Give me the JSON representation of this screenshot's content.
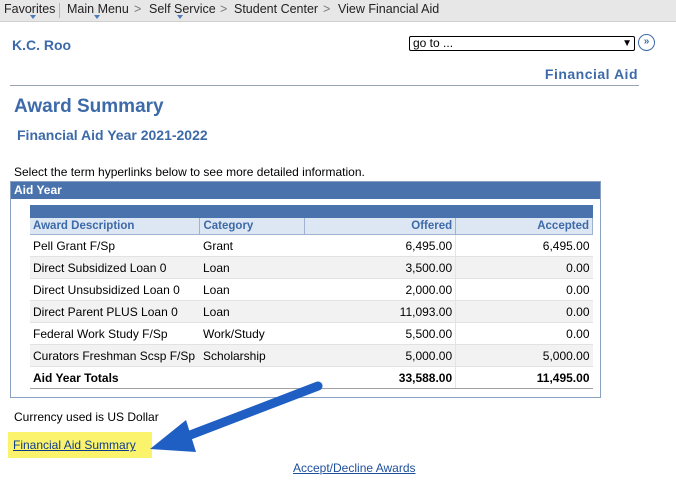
{
  "nav": {
    "favorites": "Favorites",
    "main_menu": "Main Menu",
    "self_service": "Self Service",
    "student_center": "Student Center",
    "view_financial_aid": "View Financial Aid",
    "separator": ">"
  },
  "header": {
    "student_name": "K.C. Roo",
    "goto_value": "go to ...",
    "page_label": "Financial Aid"
  },
  "main": {
    "title": "Award Summary",
    "aid_year_title": "Financial Aid Year 2021-2022",
    "instructions": "Select the term hyperlinks below to see more detailed information.",
    "aid_year_header": "Aid Year",
    "table": {
      "columns": [
        "Award Description",
        "Category",
        "Offered",
        "Accepted"
      ],
      "rows": [
        [
          "Pell Grant F/Sp",
          "Grant",
          "6,495.00",
          "6,495.00"
        ],
        [
          "Direct Subsidized Loan 0",
          "Loan",
          "3,500.00",
          "0.00"
        ],
        [
          "Direct Unsubsidized Loan 0",
          "Loan",
          "2,000.00",
          "0.00"
        ],
        [
          "Direct Parent PLUS Loan 0",
          "Loan",
          "11,093.00",
          "0.00"
        ],
        [
          "Federal Work Study F/Sp",
          "Work/Study",
          "5,500.00",
          "0.00"
        ],
        [
          "Curators Freshman Scsp F/Sp",
          "Scholarship",
          "5,000.00",
          "5,000.00"
        ]
      ],
      "total": [
        "Aid Year Totals",
        "",
        "33,588.00",
        "11,495.00"
      ]
    },
    "currency_note": "Currency used is US Dollar",
    "summary_link": "Financial Aid Summary",
    "accept_link": "Accept/Decline Awards"
  },
  "colors": {
    "accent": "#3d6aa8",
    "header_band": "#4a73ae",
    "highlight": "#fbf36c",
    "annotation_arrow": "#1f5fc4"
  }
}
